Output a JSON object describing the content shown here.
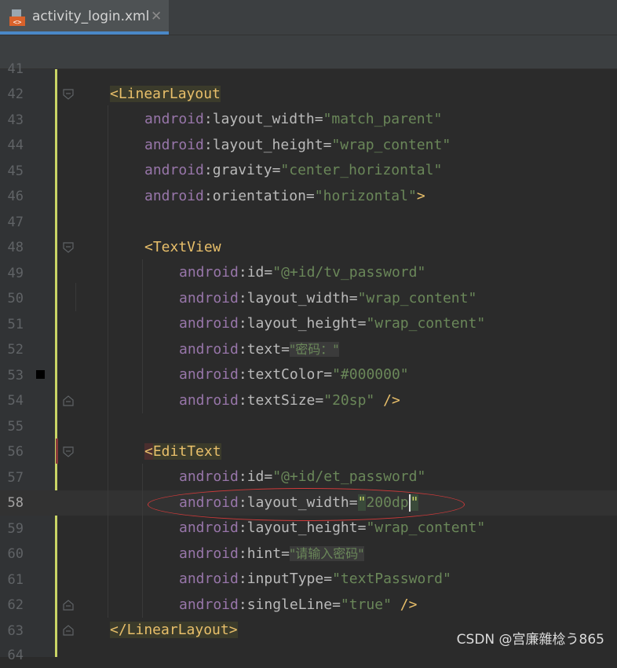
{
  "tab": {
    "filename": "activity_login.xml",
    "close": "✕"
  },
  "top_partial_line": "41",
  "lines": [
    {
      "n": "42"
    },
    {
      "n": "43"
    },
    {
      "n": "44"
    },
    {
      "n": "45"
    },
    {
      "n": "46"
    },
    {
      "n": "47"
    },
    {
      "n": "48"
    },
    {
      "n": "49"
    },
    {
      "n": "50"
    },
    {
      "n": "51"
    },
    {
      "n": "52"
    },
    {
      "n": "53"
    },
    {
      "n": "54"
    },
    {
      "n": "55"
    },
    {
      "n": "56"
    },
    {
      "n": "57"
    },
    {
      "n": "58"
    },
    {
      "n": "59"
    },
    {
      "n": "60"
    },
    {
      "n": "61"
    },
    {
      "n": "62"
    },
    {
      "n": "63"
    }
  ],
  "bottom_partial_line": "64",
  "code": {
    "linearlayout_open": "<LinearLayout",
    "ns": "android",
    "colon": ":",
    "eq": "=",
    "layout_width": "layout_width",
    "layout_height": "layout_height",
    "gravity": "gravity",
    "orientation": "orientation",
    "id": "id",
    "text": "text",
    "textColor": "textColor",
    "textSize": "textSize",
    "hint": "hint",
    "inputType": "inputType",
    "singleLine": "singleLine",
    "v_match_parent": "\"match_parent\"",
    "v_wrap_content": "\"wrap_content\"",
    "v_center_horizontal": "\"center_horizontal\"",
    "v_horizontal": "\"horizontal\"",
    "close_gt": ">",
    "textview_open": "<TextView",
    "v_tv_password": "\"@+id/tv_password\"",
    "v_text_mima": "\"密码：\"",
    "v_color": "\"#000000\"",
    "v_20sp": "\"20sp\"",
    "self_close": " />",
    "edittext_lt": "<",
    "edittext_name": "EditText",
    "v_et_password": "\"@+id/et_password\"",
    "q_open": "\"",
    "v_200dp": "200dp",
    "q_close": "\"",
    "v_hint": "\"请输入密码\"",
    "v_textPassword": "\"textPassword\"",
    "v_true": "\"true\"",
    "linearlayout_close": "</LinearLayout>"
  },
  "colors": {
    "tag": "#e8bf6a",
    "namespace": "#9876aa",
    "string": "#6a8759",
    "annotation": "#d03a3a"
  },
  "watermark": "CSDN @宫廉雜棯う865"
}
